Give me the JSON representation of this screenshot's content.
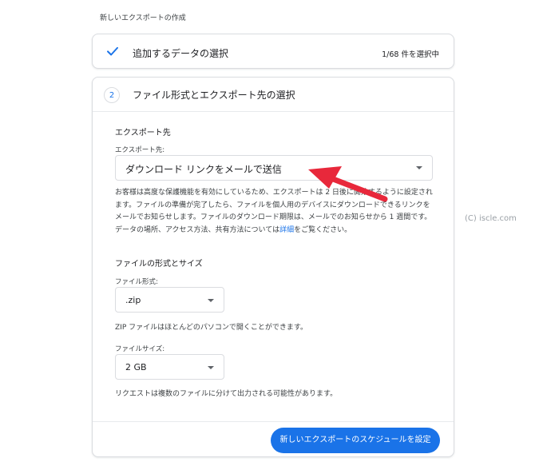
{
  "page": {
    "title": "新しいエクスポートの作成"
  },
  "step1": {
    "title": "追加するデータの選択",
    "count": "1/68 件を選択中",
    "icon": "check-icon",
    "icon_color": "#1a73e8"
  },
  "step2": {
    "number": "2",
    "title": "ファイル形式とエクスポート先の選択",
    "destination_section": "エクスポート先",
    "destination_label": "エクスポート先:",
    "destination_value": "ダウンロード リンクをメールで送信",
    "description_part1": "お客様は高度な保護機能を有効にしているため、エクスポートは 2 日後に開始するように設定されます。ファイルの準備が完了したら、ファイルを個人用のデバイスにダウンロードできるリンクをメールでお知らせします。ファイルのダウンロード期限は、メールでのお知らせから 1 週間です。 データの場所、アクセス方法、共有方法については",
    "description_link": "詳細",
    "description_part2": "をご覧ください。",
    "format_section": "ファイルの形式とサイズ",
    "type_label": "ファイル形式:",
    "type_value": ".zip",
    "type_note": "ZIP ファイルはほとんどのパソコンで開くことができます。",
    "size_label": "ファイルサイズ:",
    "size_value": "2 GB",
    "size_note": "リクエストは複数のファイルに分けて出力される可能性があります。",
    "submit_label": "新しいエクスポートのスケジュールを設定"
  },
  "watermark": "(C) iscle.com",
  "colors": {
    "accent": "#1a73e8",
    "annotation_arrow": "#e8283b"
  }
}
